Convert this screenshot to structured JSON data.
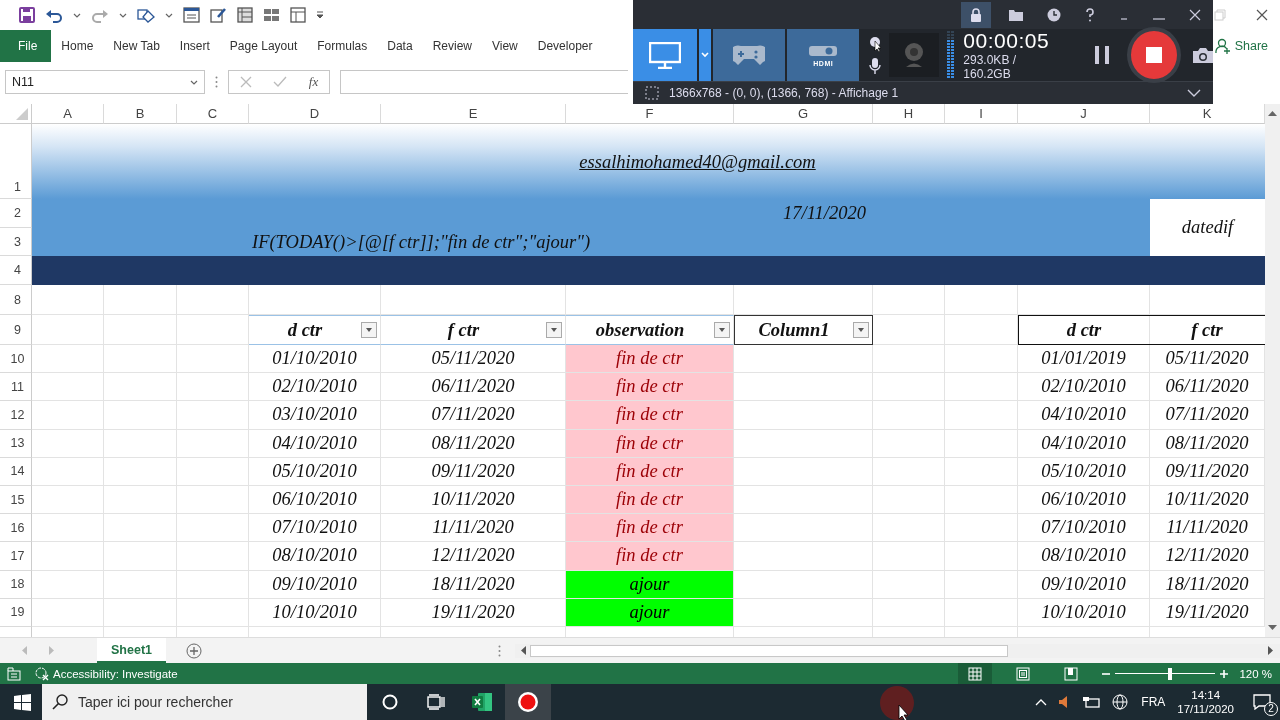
{
  "ribbon_tabs": [
    {
      "label": "File",
      "kind": "file"
    },
    {
      "label": "Home",
      "kind": "tab"
    },
    {
      "label": "New Tab",
      "kind": "tab"
    },
    {
      "label": "Insert",
      "kind": "tab"
    },
    {
      "label": "Page Layout",
      "kind": "tab"
    },
    {
      "label": "Formulas",
      "kind": "tab"
    },
    {
      "label": "Data",
      "kind": "tab"
    },
    {
      "label": "Review",
      "kind": "tab"
    },
    {
      "label": "View",
      "kind": "tab"
    },
    {
      "label": "Developer",
      "kind": "tab"
    }
  ],
  "share_button": {
    "label": "Share"
  },
  "name_box": {
    "value": "N11"
  },
  "formula_bar": {
    "function_label": "fx"
  },
  "column_headers": [
    "A",
    "B",
    "C",
    "D",
    "E",
    "F",
    "G",
    "H",
    "I",
    "J",
    "K"
  ],
  "row_headers": [
    "1",
    "2",
    "3",
    "4",
    "8",
    "9",
    "10",
    "11",
    "12",
    "13",
    "14",
    "15",
    "16",
    "17",
    "18",
    "19"
  ],
  "banner": {
    "email": "essalhimohamed40@gmail.com",
    "date": "17/11/2020",
    "formula": "IF(TODAY()>[@[f ctr]];\"fin de ctr\";\"ajour\")",
    "label": "datedif"
  },
  "table": {
    "columns": [
      {
        "label": "d ctr",
        "filter": true
      },
      {
        "label": "f ctr",
        "filter": true
      },
      {
        "label": "observation",
        "filter": true
      },
      {
        "label": "Column1",
        "filter": true
      }
    ],
    "rows": [
      {
        "d_ctr": "01/10/2010",
        "f_ctr": "05/11/2020",
        "observation": "fin de ctr",
        "color": "#ffc7ce"
      },
      {
        "d_ctr": "02/10/2010",
        "f_ctr": "06/11/2020",
        "observation": "fin de ctr",
        "color": "#ffc7ce"
      },
      {
        "d_ctr": "03/10/2010",
        "f_ctr": "07/11/2020",
        "observation": "fin de ctr",
        "color": "#ffc7ce"
      },
      {
        "d_ctr": "04/10/2010",
        "f_ctr": "08/11/2020",
        "observation": "fin de ctr",
        "color": "#ffc7ce"
      },
      {
        "d_ctr": "05/10/2010",
        "f_ctr": "09/11/2020",
        "observation": "fin de ctr",
        "color": "#ffc7ce"
      },
      {
        "d_ctr": "06/10/2010",
        "f_ctr": "10/11/2020",
        "observation": "fin de ctr",
        "color": "#ffc7ce"
      },
      {
        "d_ctr": "07/10/2010",
        "f_ctr": "11/11/2020",
        "observation": "fin de ctr",
        "color": "#ffc7ce"
      },
      {
        "d_ctr": "08/10/2010",
        "f_ctr": "12/11/2020",
        "observation": "fin de ctr",
        "color": "#ffc7ce"
      },
      {
        "d_ctr": "09/10/2010",
        "f_ctr": "18/11/2020",
        "observation": "ajour",
        "color": "#00ff00"
      },
      {
        "d_ctr": "10/10/2010",
        "f_ctr": "19/11/2020",
        "observation": "ajour",
        "color": "#00ff00"
      }
    ]
  },
  "side_table": {
    "columns": [
      "d ctr",
      "f ctr"
    ],
    "rows": [
      [
        "01/01/2019",
        "05/11/2020"
      ],
      [
        "02/10/2010",
        "06/11/2020"
      ],
      [
        "04/10/2010",
        "07/11/2020"
      ],
      [
        "04/10/2010",
        "08/11/2020"
      ],
      [
        "05/10/2010",
        "09/11/2020"
      ],
      [
        "06/10/2010",
        "10/11/2020"
      ],
      [
        "07/10/2010",
        "11/11/2020"
      ],
      [
        "08/10/2010",
        "12/11/2020"
      ],
      [
        "09/10/2010",
        "18/11/2020"
      ],
      [
        "10/10/2010",
        "19/11/2020"
      ]
    ]
  },
  "sheet_tabs": [
    {
      "label": "Sheet1",
      "selected": true
    }
  ],
  "status_bar": {
    "accessibility": "Accessibility: Investigate",
    "views": [
      {
        "kind": "normal",
        "selected": true
      },
      {
        "kind": "page_layout",
        "selected": false
      },
      {
        "kind": "page_break",
        "selected": false
      }
    ],
    "zoom": {
      "level": 0.55,
      "label": "120 %"
    }
  },
  "recorder": {
    "modes": [
      {
        "kind": "screen",
        "selected": true
      },
      {
        "kind": "game",
        "selected": false
      },
      {
        "kind": "hdmi",
        "label": "HDMI",
        "selected": false
      }
    ],
    "timer": "00:00:05",
    "file_size": "293.0KB / 160.2GB",
    "region": "1366x768 - (0, 0), (1366, 768) - Affichage 1"
  },
  "taskbar": {
    "search_placeholder": "Taper ici pour rechercher",
    "apps": [
      {
        "kind": "cortana",
        "selected": false
      },
      {
        "kind": "task_view",
        "selected": false
      },
      {
        "kind": "excel",
        "selected": false
      },
      {
        "kind": "recorder",
        "selected": true
      }
    ],
    "language": "FRA",
    "time": "14:14",
    "date": "17/11/2020",
    "notification_count": "2"
  }
}
